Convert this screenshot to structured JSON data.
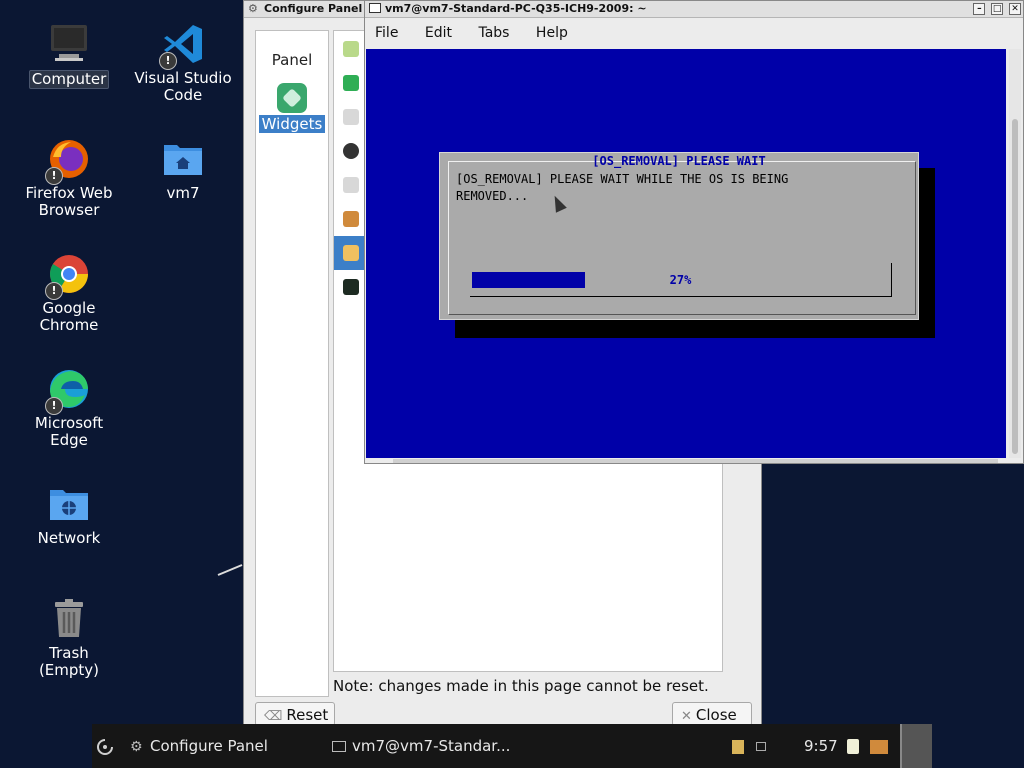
{
  "desktop": {
    "icons": [
      {
        "label_line1": "Computer",
        "label_line2": ""
      },
      {
        "label_line1": "Visual Studio",
        "label_line2": "Code"
      },
      {
        "label_line1": "Firefox Web",
        "label_line2": "Browser"
      },
      {
        "label_line1": "vm7",
        "label_line2": ""
      },
      {
        "label_line1": "Google",
        "label_line2": "Chrome"
      },
      {
        "label_line1": "Microsoft",
        "label_line2": "Edge"
      },
      {
        "label_line1": "Network",
        "label_line2": ""
      },
      {
        "label_line1": "Trash",
        "label_line2": "(Empty)"
      }
    ],
    "badge": "!"
  },
  "configure_panel": {
    "title": "Configure Panel",
    "sidebar": [
      {
        "label": "Panel"
      },
      {
        "label": "Widgets"
      }
    ],
    "note": "Note: changes made in this page cannot be reset.",
    "reset_label": "Reset",
    "close_label": "Close"
  },
  "terminal": {
    "title": "vm7@vm7-Standard-PC-Q35-ICH9-2009: ~",
    "menu": [
      "File",
      "Edit",
      "Tabs",
      "Help"
    ],
    "dialog": {
      "title": "[OS_REMOVAL] PLEASE WAIT",
      "text_line1": "[OS_REMOVAL] PLEASE WAIT WHILE THE OS IS BEING",
      "text_line2": "REMOVED...",
      "progress_percent": 27,
      "progress_label": "27%"
    }
  },
  "taskbar": {
    "task1": "Configure Panel",
    "task2": "vm7@vm7-Standar...",
    "clock": "9:57"
  },
  "colors": {
    "terminal_bg": "#0000a8",
    "desktop_bg": "#0b1733",
    "selection": "#3c7fc8"
  }
}
